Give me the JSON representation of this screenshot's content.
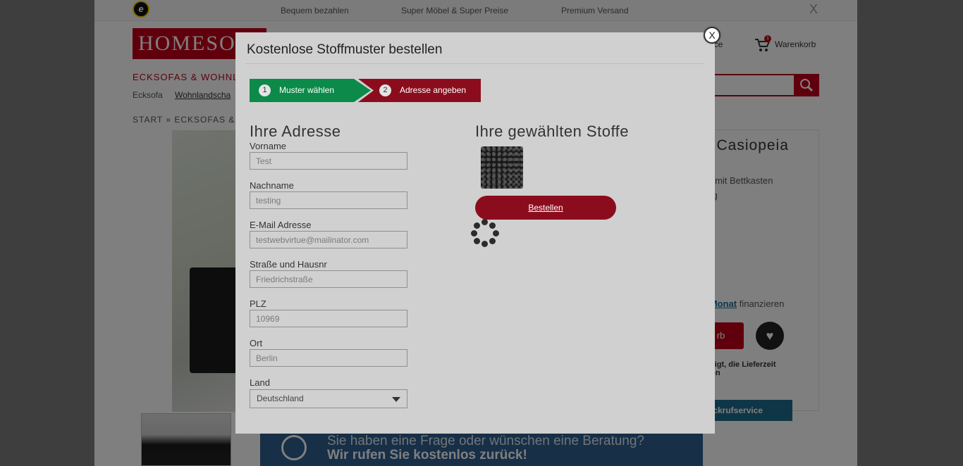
{
  "background": {
    "topbar": {
      "items": [
        "Bequem bezahlen",
        "Super Möbel & Super Preise",
        "Premium Versand"
      ],
      "close_label": "X"
    },
    "header": {
      "logo": "HOMESO",
      "service_label": "vice",
      "cart_count": "1",
      "cart_label": "Warenkorb"
    },
    "nav": {
      "main": "ECKSOFAS & WOHNL",
      "sub1": "Ecksofa",
      "sub2": "Wohnlandscha"
    },
    "breadcrumb": "START  »  ECKSOFAS &",
    "product": {
      "title": "ft Casiopeia",
      "line1": "on mit Bettkasten",
      "line2": "ung",
      "finance_amount": "€/Monat",
      "finance_suffix": " finanzieren",
      "cart_button": "rb",
      "note_line1": "fertigt, die Lieferzeit",
      "note_line2": "chen",
      "callback_button": "ückrufservice"
    },
    "banner": {
      "line1": "Sie haben eine Frage oder wünschen eine Beratung?",
      "line2": "Wir rufen Sie kostenlos zurück!"
    }
  },
  "modal": {
    "title": "Kostenlose Stoffmuster bestellen",
    "close_label": "X",
    "steps": [
      {
        "num": "1",
        "label": "Muster wählen",
        "color": "#0b8a4a"
      },
      {
        "num": "2",
        "label": "Adresse angeben",
        "color": "#8b0d1d"
      }
    ],
    "address": {
      "heading": "Ihre Adresse",
      "fields": [
        {
          "label": "Vorname",
          "value": "Test"
        },
        {
          "label": "Nachname",
          "value": "testing"
        },
        {
          "label": "E-Mail Adresse",
          "value": "testwebvirtue@mailinator.com"
        },
        {
          "label": "Straße und Hausnr",
          "value": "Friedrichstraße"
        },
        {
          "label": "PLZ",
          "value": "10969"
        },
        {
          "label": "Ort",
          "value": "Berlin"
        }
      ],
      "country_label": "Land",
      "country_value": "Deutschland"
    },
    "fabrics": {
      "heading": "Ihre gewählten Stoffe",
      "order_button": "Bestellen"
    }
  }
}
